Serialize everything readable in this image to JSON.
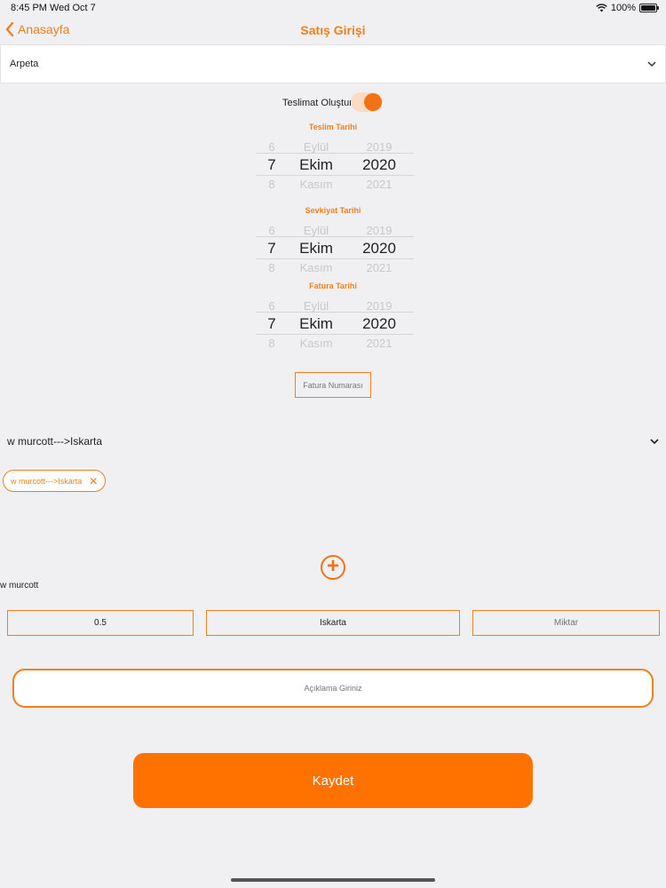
{
  "status_bar": {
    "time": "8:45 PM",
    "date": "Wed Oct 7",
    "battery": "100%"
  },
  "nav": {
    "back_label": "Anasayfa",
    "title": "Satış Girişi"
  },
  "company_select": {
    "value": "Arpeta"
  },
  "delivery_toggle": {
    "label": "Teslimat Oluştur",
    "on": true
  },
  "pickers": [
    {
      "title": "Teslim Tarihi",
      "prev": [
        "6",
        "Eylül",
        "2019"
      ],
      "current": [
        "7",
        "Ekim",
        "2020"
      ],
      "next": [
        "8",
        "Kasım",
        "2021"
      ]
    },
    {
      "title": "Sevkiyat Tarihi",
      "prev": [
        "6",
        "Eylül",
        "2019"
      ],
      "current": [
        "7",
        "Ekim",
        "2020"
      ],
      "next": [
        "8",
        "Kasım",
        "2021"
      ]
    },
    {
      "title": "Fatura Tarihi",
      "prev": [
        "6",
        "Eylül",
        "2019"
      ],
      "current": [
        "7",
        "Ekim",
        "2020"
      ],
      "next": [
        "8",
        "Kasım",
        "2021"
      ]
    }
  ],
  "invoice": {
    "placeholder": "Fatura Numarası"
  },
  "product_select": {
    "value": "w murcott--->Iskarta"
  },
  "selected_chip": {
    "label": "w murcott--->Iskarta"
  },
  "item": {
    "name": "w murcott",
    "quantity": "0.5",
    "type": "Iskarta",
    "amount_placeholder": "Miktar"
  },
  "description": {
    "placeholder": "Açıklama Giriniz"
  },
  "save_button": {
    "label": "Kaydet"
  },
  "colors": {
    "accent": "#f07f1e",
    "button": "#ff7200"
  }
}
